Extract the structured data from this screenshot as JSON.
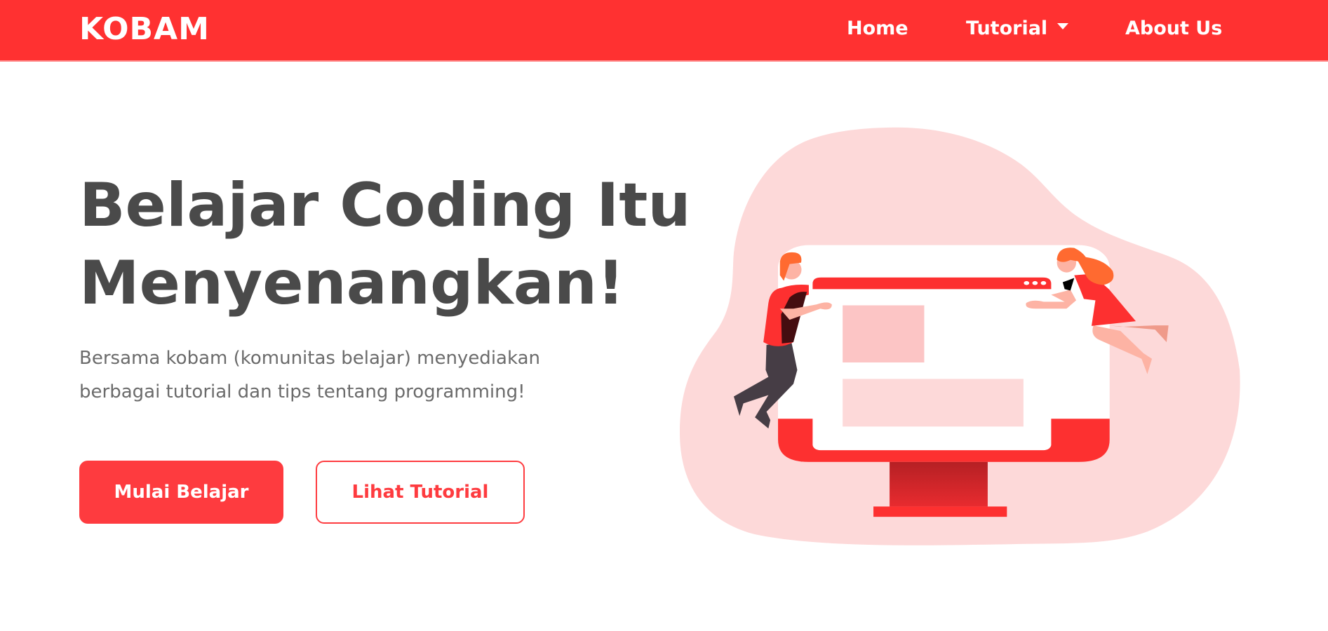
{
  "navbar": {
    "brand": "KOBAM",
    "links": [
      {
        "label": "Home"
      },
      {
        "label": "Tutorial",
        "has_dropdown": true
      },
      {
        "label": "About Us"
      }
    ],
    "background_color": "#ff3131"
  },
  "hero": {
    "title_line1": "Belajar Coding Itu",
    "title_line2": "Menyenangkan!",
    "description_line1": "Bersama kobam (komunitas belajar) menyediakan",
    "description_line2": "berbagai tutorial dan tips tentang programming!",
    "primary_button": "Mulai Belajar",
    "secondary_button": "Lihat Tutorial",
    "accent_color": "#fe3b3f"
  },
  "illustration": {
    "subject": "two-people-assembling-website-on-monitor"
  }
}
